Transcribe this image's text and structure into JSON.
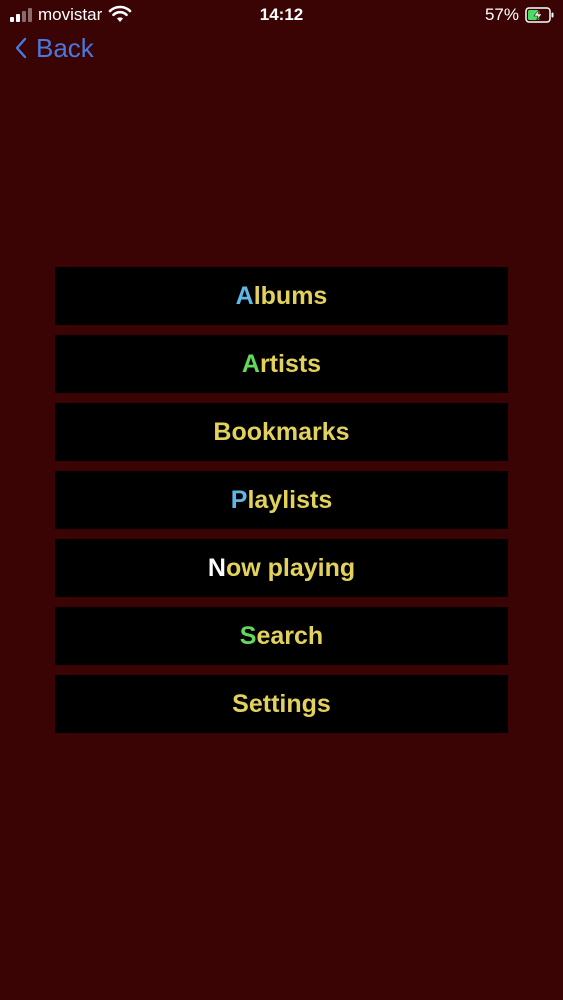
{
  "status_bar": {
    "carrier": "movistar",
    "time": "14:12",
    "battery_percent": "57%",
    "battery_level": 0.57,
    "signal_bars_active": 2,
    "signal_bars_total": 4,
    "icons": [
      "signal-icon",
      "wifi-icon",
      "battery-charging-icon"
    ]
  },
  "nav": {
    "back_label": "Back",
    "back_color": "#4a78e0"
  },
  "menu": {
    "text_color": "#e2d25c",
    "items": [
      {
        "first": "A",
        "rest": "lbums",
        "first_color": "#5fb8e8"
      },
      {
        "first": "A",
        "rest": "rtists",
        "first_color": "#62d85c"
      },
      {
        "first": "B",
        "rest": "ookmarks",
        "first_color": "#e2d25c"
      },
      {
        "first": "P",
        "rest": "laylists",
        "first_color": "#5fb8e8"
      },
      {
        "first": "N",
        "rest": "ow playing",
        "first_color": "#ffffff"
      },
      {
        "first": "S",
        "rest": "earch",
        "first_color": "#62d85c"
      },
      {
        "first": "S",
        "rest": "ettings",
        "first_color": "#e2d25c"
      }
    ]
  },
  "colors": {
    "background": "#3a0405",
    "button_bg": "#000000"
  }
}
